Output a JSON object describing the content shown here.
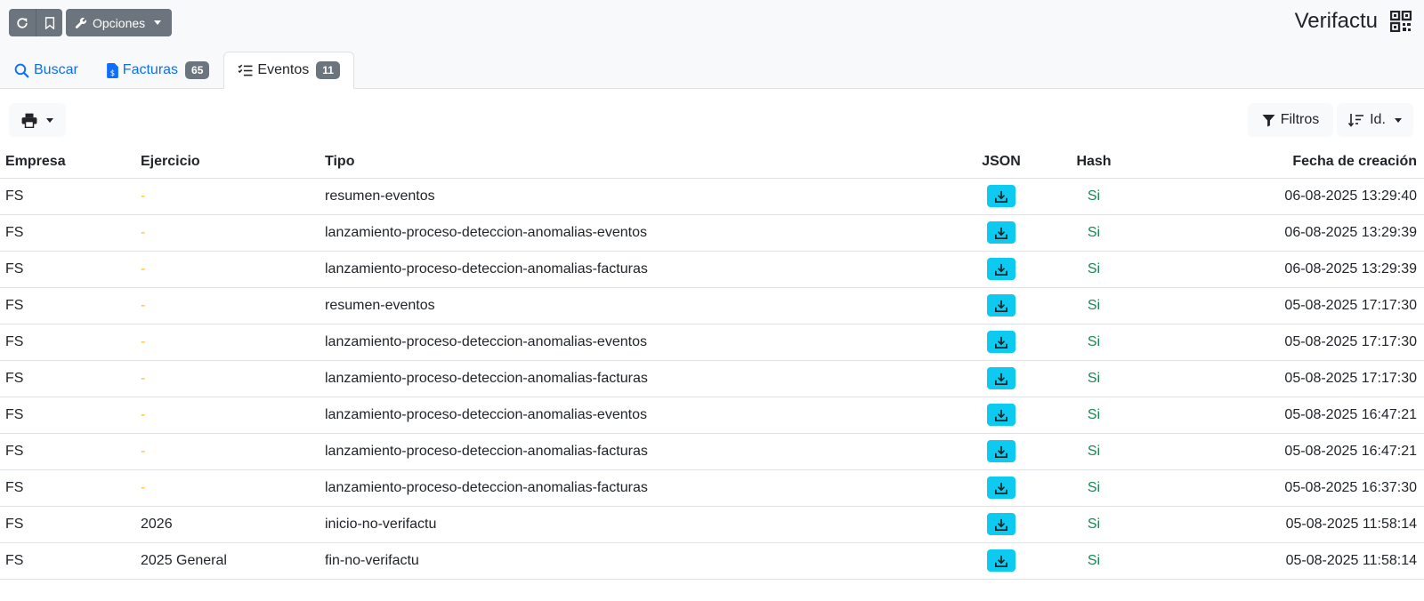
{
  "app": {
    "title": "Verifactu"
  },
  "toolbar_top": {
    "opciones_label": "Opciones"
  },
  "tabs": [
    {
      "label": "Buscar",
      "count": ""
    },
    {
      "label": "Facturas",
      "count": "65"
    },
    {
      "label": "Eventos",
      "count": "11"
    }
  ],
  "list_toolbar": {
    "filtros_label": "Filtros",
    "orden_label": "Id."
  },
  "table": {
    "headers": {
      "empresa": "Empresa",
      "ejercicio": "Ejercicio",
      "tipo": "Tipo",
      "json": "JSON",
      "hash": "Hash",
      "fecha": "Fecha de creación"
    },
    "rows": [
      {
        "empresa": "FS",
        "ejercicio": "-",
        "tipo": "resumen-eventos",
        "hash": "Si",
        "fecha": "06-08-2025 13:29:40"
      },
      {
        "empresa": "FS",
        "ejercicio": "-",
        "tipo": "lanzamiento-proceso-deteccion-anomalias-eventos",
        "hash": "Si",
        "fecha": "06-08-2025 13:29:39"
      },
      {
        "empresa": "FS",
        "ejercicio": "-",
        "tipo": "lanzamiento-proceso-deteccion-anomalias-facturas",
        "hash": "Si",
        "fecha": "06-08-2025 13:29:39"
      },
      {
        "empresa": "FS",
        "ejercicio": "-",
        "tipo": "resumen-eventos",
        "hash": "Si",
        "fecha": "05-08-2025 17:17:30"
      },
      {
        "empresa": "FS",
        "ejercicio": "-",
        "tipo": "lanzamiento-proceso-deteccion-anomalias-eventos",
        "hash": "Si",
        "fecha": "05-08-2025 17:17:30"
      },
      {
        "empresa": "FS",
        "ejercicio": "-",
        "tipo": "lanzamiento-proceso-deteccion-anomalias-facturas",
        "hash": "Si",
        "fecha": "05-08-2025 17:17:30"
      },
      {
        "empresa": "FS",
        "ejercicio": "-",
        "tipo": "lanzamiento-proceso-deteccion-anomalias-eventos",
        "hash": "Si",
        "fecha": "05-08-2025 16:47:21"
      },
      {
        "empresa": "FS",
        "ejercicio": "-",
        "tipo": "lanzamiento-proceso-deteccion-anomalias-facturas",
        "hash": "Si",
        "fecha": "05-08-2025 16:47:21"
      },
      {
        "empresa": "FS",
        "ejercicio": "-",
        "tipo": "lanzamiento-proceso-deteccion-anomalias-facturas",
        "hash": "Si",
        "fecha": "05-08-2025 16:37:30"
      },
      {
        "empresa": "FS",
        "ejercicio": "2026",
        "tipo": "inicio-no-verifactu",
        "hash": "Si",
        "fecha": "05-08-2025 11:58:14"
      },
      {
        "empresa": "FS",
        "ejercicio": "2025 General",
        "tipo": "fin-no-verifactu",
        "hash": "Si",
        "fecha": "05-08-2025 11:58:14"
      }
    ]
  },
  "colors": {
    "link": "#0d6efd",
    "secondary": "#6c757d",
    "info": "#0dcaf0",
    "warning": "#ffc107",
    "success": "#198754"
  },
  "icons": {
    "reload": "reload-icon",
    "bookmark": "bookmark-icon",
    "wrench": "wrench-icon",
    "qr": "qr-code-icon",
    "search": "search-icon",
    "invoice": "invoice-icon",
    "list": "list-check-icon",
    "print": "printer-icon",
    "filter": "filter-icon",
    "sort": "sort-icon",
    "download": "download-icon"
  }
}
